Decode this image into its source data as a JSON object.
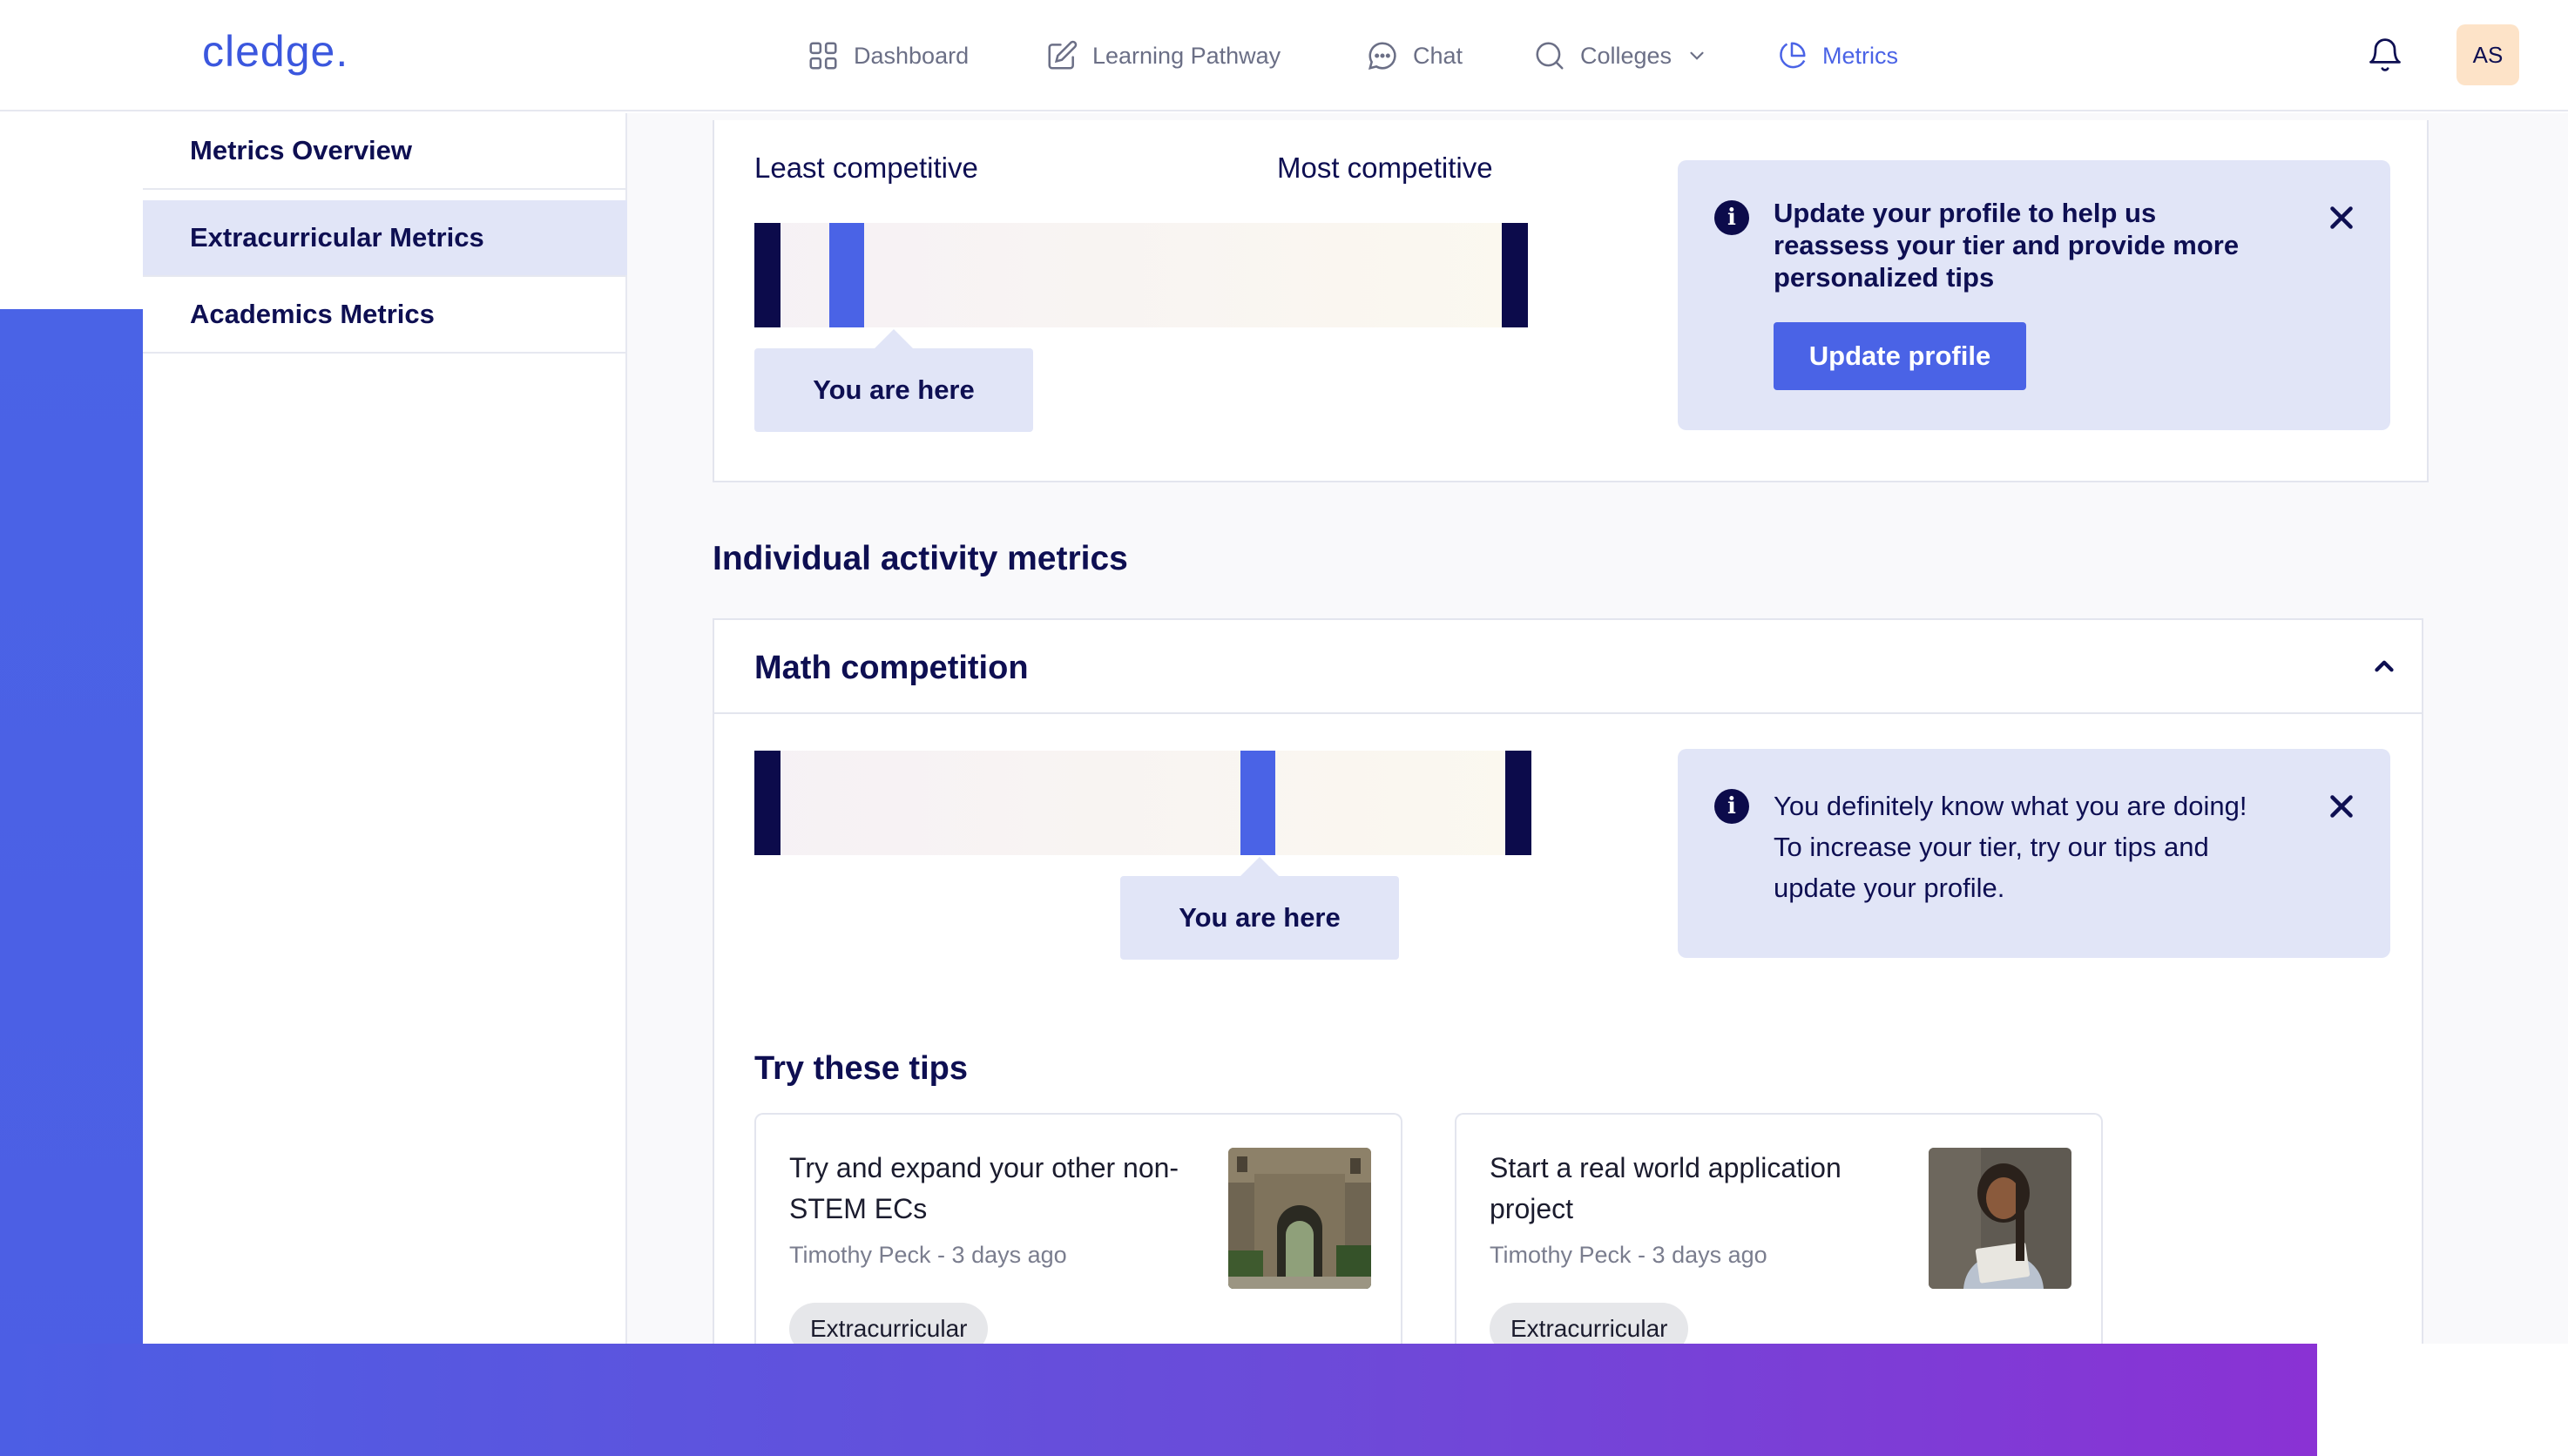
{
  "brand": {
    "logo": "cledge."
  },
  "nav": {
    "items": [
      {
        "label": "Dashboard",
        "icon": "grid-icon"
      },
      {
        "label": "Learning Pathway",
        "icon": "edit-icon"
      },
      {
        "label": "Chat",
        "icon": "chat-bubble-icon"
      },
      {
        "label": "Colleges",
        "icon": "search-icon"
      },
      {
        "label": "Metrics",
        "icon": "pie-chart-icon"
      }
    ],
    "active": "Metrics",
    "avatar_initials": "AS"
  },
  "sidebar": {
    "items": [
      {
        "label": "Metrics Overview"
      },
      {
        "label": "Extracurricular Metrics"
      },
      {
        "label": "Academics Metrics"
      }
    ],
    "active": "Extracurricular Metrics"
  },
  "overall": {
    "least_label": "Least competitive",
    "most_label": "Most competitive",
    "you_are_here": "You are here",
    "position_fraction": 0.1,
    "info": {
      "text": "Update your profile to help us reassess your tier and provide more personalized tips",
      "button": "Update profile"
    }
  },
  "individual": {
    "title": "Individual activity metrics",
    "activity": {
      "name": "Math competition",
      "you_are_here": "You are here",
      "position_fraction": 0.64,
      "info": {
        "text": "You definitely know what you are doing! To increase your tier, try our tips and update your profile."
      }
    },
    "tips_title": "Try these tips",
    "tips": [
      {
        "title": "Try and expand your other non-STEM ECs",
        "author": "Timothy Peck",
        "age": "3 days ago",
        "tag": "Extracurricular"
      },
      {
        "title": "Start a real world application project",
        "author": "Timothy Peck",
        "age": "3 days ago",
        "tag": "Extracurricular"
      }
    ]
  },
  "colors": {
    "accent": "#4a63e6",
    "navy": "#0c0b4b",
    "info_bg": "#e1e5f7",
    "avatar_bg": "#fde3c8",
    "gradient_end": "#8a32d4"
  }
}
